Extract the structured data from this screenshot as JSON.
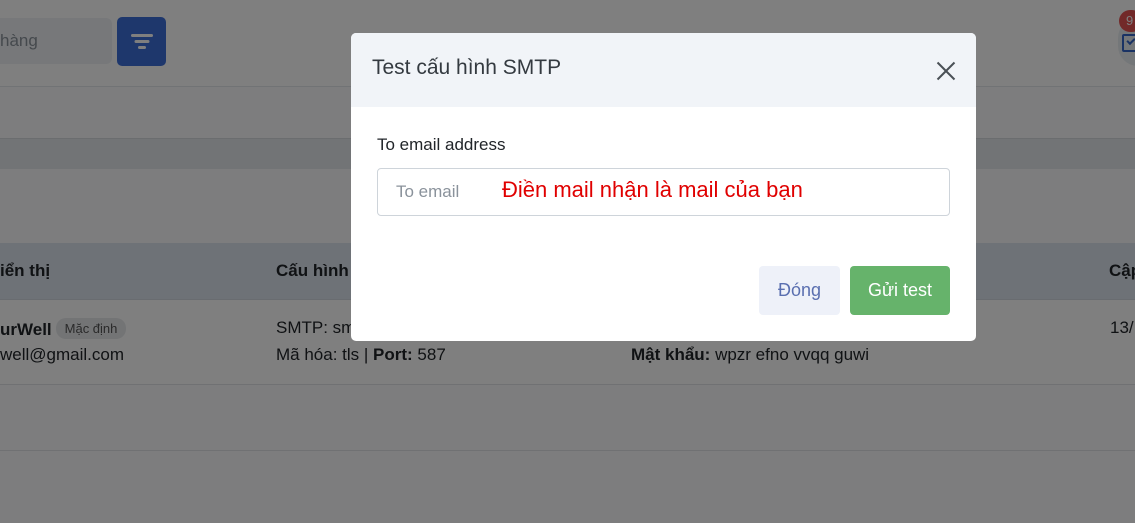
{
  "background": {
    "search": {
      "value": "hàng"
    },
    "badge_count": "9",
    "table": {
      "headers": [
        "iển thị",
        "Cấu hình",
        "Cập"
      ],
      "row": {
        "name": "urWell",
        "default_tag": "Mặc định",
        "email": "well@gmail.com",
        "smtp_line": "SMTP: sm",
        "encryption_label": "Mã hóa: tls | ",
        "port_label": "Port:",
        "port_value": " 587",
        "password_label": "Mật khẩu:",
        "password_value": " wpzr efno vvqq guwi",
        "updated": "13/"
      }
    }
  },
  "modal": {
    "title": "Test cấu hình SMTP",
    "field_label": "To email address",
    "input_placeholder": "To email",
    "input_value": "",
    "hint": "Điền mail nhận là mail của bạn",
    "close_label": "Đóng",
    "send_label": "Gửi test"
  },
  "colors": {
    "primary": "#3d6fd8",
    "success": "#66b36b",
    "danger_badge": "#e55353",
    "hint_red": "#e00000"
  }
}
